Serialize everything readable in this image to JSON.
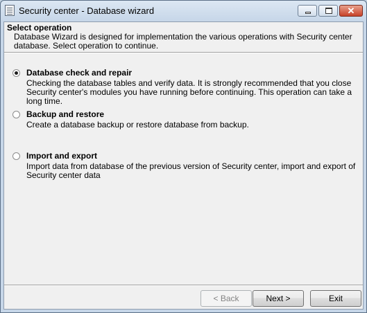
{
  "window": {
    "title": "Security center - Database wizard",
    "close_glyph": "✕"
  },
  "header": {
    "title": "Select operation",
    "description": "Database Wizard is designed for implementation the various operations with Security center database. Select operation to continue."
  },
  "options": [
    {
      "label": "Database check and repair",
      "description": "Checking the database tables and verify data. It is strongly recommended that you close Security center's modules you have running before continuing. This operation can take a long time.",
      "selected": true
    },
    {
      "label": "Backup and restore",
      "description": "Create a database backup or restore database from backup.",
      "selected": false
    },
    {
      "label": "Import and export",
      "description": "Import data from database of the previous version of Security center, import and export of Security center data",
      "selected": false
    }
  ],
  "buttons": {
    "back": "< Back",
    "next": "Next >",
    "exit": "Exit"
  }
}
